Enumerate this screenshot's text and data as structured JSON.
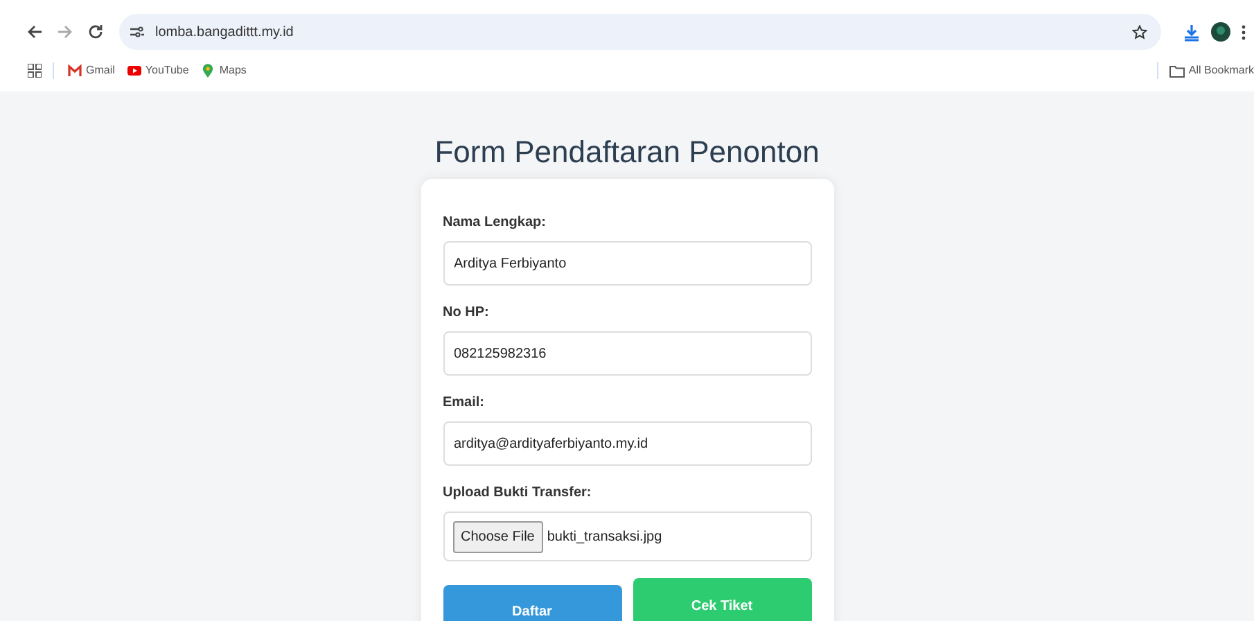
{
  "browser": {
    "url": "lomba.bangadittt.my.id",
    "bookmarks": [
      {
        "label": "Gmail",
        "kind": "gmail"
      },
      {
        "label": "YouTube",
        "kind": "youtube"
      },
      {
        "label": "Maps",
        "kind": "maps"
      }
    ],
    "all_bookmarks": "All Bookmark"
  },
  "form": {
    "title": "Form Pendaftaran Penonton",
    "fields": [
      {
        "label": "Nama Lengkap:",
        "kind": "text",
        "value": "Arditya Ferbiyanto"
      },
      {
        "label": "No HP:",
        "kind": "text",
        "value": "082125982316"
      },
      {
        "label": "Email:",
        "kind": "text",
        "value": "arditya@ardityaferbiyanto.my.id"
      },
      {
        "label": "Upload Bukti Transfer:",
        "kind": "file",
        "button": "Choose File",
        "value": "bukti_transaksi.jpg"
      }
    ],
    "buttons": [
      {
        "label": "Daftar",
        "kind": "primary"
      },
      {
        "label": "Cek Tiket",
        "kind": "success"
      }
    ]
  }
}
